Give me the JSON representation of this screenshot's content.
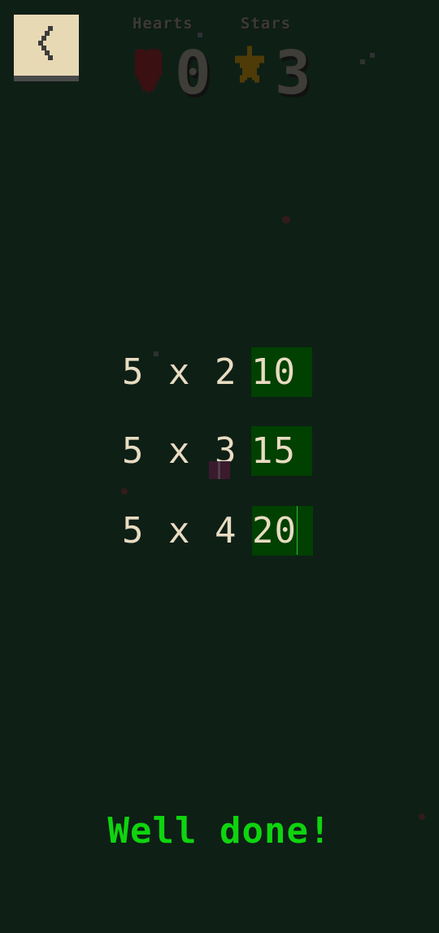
{
  "header": {
    "back_label": "back",
    "hearts_label": "Hearts",
    "hearts_value": "0",
    "stars_label": "Stars",
    "stars_value": "3"
  },
  "problems": [
    {
      "equation": "5 x 2",
      "answer": "10"
    },
    {
      "equation": "5 x 3",
      "answer": "15"
    },
    {
      "equation": "5 x 4",
      "answer": "20"
    }
  ],
  "message": "Well done!",
  "colors": {
    "background": "#0e1f16",
    "answer_box": "#004000",
    "message": "#0fd40f",
    "text": "#e8dcc2"
  }
}
